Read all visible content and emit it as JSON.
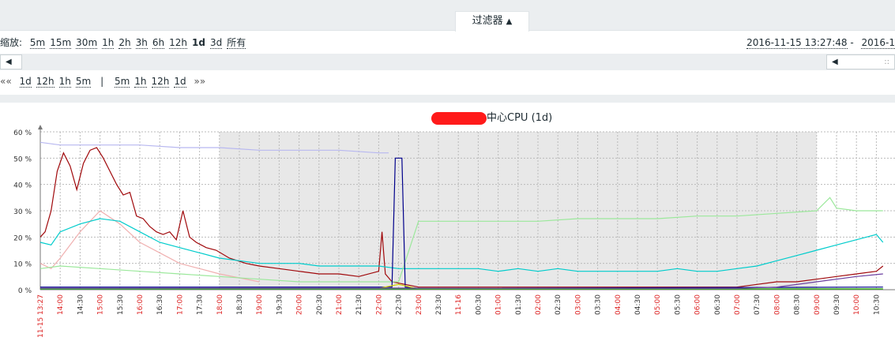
{
  "filter": {
    "label": "过滤器",
    "arrow": "▲"
  },
  "zoom": {
    "label": "缩放:",
    "options": [
      "5m",
      "15m",
      "30m",
      "1h",
      "2h",
      "3h",
      "6h",
      "12h",
      "1d",
      "3d",
      "所有"
    ],
    "active": "1d"
  },
  "date_range": {
    "from": "2016-11-15 13:27:48",
    "separator": " - ",
    "to": "2016-1"
  },
  "nav": {
    "back": "««",
    "left": [
      "1d",
      "12h",
      "1h",
      "5m"
    ],
    "divider": "|",
    "right": [
      "5m",
      "1h",
      "12h",
      "1d"
    ],
    "forward": "»»"
  },
  "scroll": {
    "left_arrow": "◀",
    "right_arrow": "◀",
    "grip": "::"
  },
  "chart_data": {
    "type": "line",
    "title": "中心CPU (1d)",
    "ylim": [
      0,
      60
    ],
    "y_ticks": [
      "0 %",
      "10 %",
      "20 %",
      "30 %",
      "40 %",
      "50 %",
      "60 %"
    ],
    "x_ticks": [
      {
        "label": "11-15 13:27",
        "red": true
      },
      {
        "label": "14:00",
        "red": true
      },
      {
        "label": "14:30",
        "red": false
      },
      {
        "label": "15:00",
        "red": true
      },
      {
        "label": "15:30",
        "red": false
      },
      {
        "label": "16:00",
        "red": true
      },
      {
        "label": "16:30",
        "red": false
      },
      {
        "label": "17:00",
        "red": true
      },
      {
        "label": "17:30",
        "red": false
      },
      {
        "label": "18:00",
        "red": true
      },
      {
        "label": "18:30",
        "red": false
      },
      {
        "label": "19:00",
        "red": true
      },
      {
        "label": "19:30",
        "red": false
      },
      {
        "label": "20:00",
        "red": true
      },
      {
        "label": "20:30",
        "red": false
      },
      {
        "label": "21:00",
        "red": true
      },
      {
        "label": "21:30",
        "red": false
      },
      {
        "label": "22:00",
        "red": true
      },
      {
        "label": "22:30",
        "red": false
      },
      {
        "label": "23:00",
        "red": true
      },
      {
        "label": "23:30",
        "red": false
      },
      {
        "label": "11-16",
        "red": true
      },
      {
        "label": "00:30",
        "red": false
      },
      {
        "label": "01:00",
        "red": true
      },
      {
        "label": "01:30",
        "red": false
      },
      {
        "label": "02:00",
        "red": true
      },
      {
        "label": "02:30",
        "red": false
      },
      {
        "label": "03:00",
        "red": true
      },
      {
        "label": "03:30",
        "red": false
      },
      {
        "label": "04:00",
        "red": true
      },
      {
        "label": "04:30",
        "red": false
      },
      {
        "label": "05:00",
        "red": true
      },
      {
        "label": "05:30",
        "red": false
      },
      {
        "label": "06:00",
        "red": true
      },
      {
        "label": "06:30",
        "red": false
      },
      {
        "label": "07:00",
        "red": true
      },
      {
        "label": "07:30",
        "red": false
      },
      {
        "label": "08:00",
        "red": true
      },
      {
        "label": "08:30",
        "red": false
      },
      {
        "label": "09:00",
        "red": true
      },
      {
        "label": "09:30",
        "red": false
      },
      {
        "label": "10:00",
        "red": true
      },
      {
        "label": "10:30",
        "red": false
      }
    ],
    "shaded_hours": {
      "from": "18:00",
      "to": "09:00"
    },
    "grid": true,
    "legend_position": "bottom",
    "series": [
      {
        "color": "#b8b8f0",
        "x": [
          "13:27",
          "14:00",
          "15:00",
          "16:00",
          "17:00",
          "18:00",
          "19:00",
          "20:00",
          "21:00",
          "22:00",
          "22:15",
          "22:20"
        ],
        "values": [
          56,
          55,
          55,
          55,
          54,
          54,
          53,
          53,
          53,
          52,
          52,
          null
        ]
      },
      {
        "color": "#a0080b",
        "x": [
          "13:27",
          "13:35",
          "13:45",
          "13:55",
          "14:05",
          "14:15",
          "14:25",
          "14:35",
          "14:45",
          "14:55",
          "15:05",
          "15:15",
          "15:25",
          "15:35",
          "15:45",
          "15:55",
          "16:05",
          "16:15",
          "16:25",
          "16:35",
          "16:45",
          "16:55",
          "17:05",
          "17:15",
          "17:25",
          "17:40",
          "17:55",
          "18:15",
          "18:40",
          "19:00",
          "19:30",
          "20:00",
          "20:30",
          "21:00",
          "21:30",
          "22:00",
          "22:05",
          "22:10",
          "22:20",
          "23:00",
          "00:00",
          "01:00",
          "02:00",
          "03:00",
          "04:00",
          "05:00",
          "06:00",
          "07:00",
          "07:30",
          "08:00",
          "08:30",
          "09:00",
          "09:30",
          "10:00",
          "10:30",
          "10:40"
        ],
        "values": [
          20,
          22,
          30,
          45,
          52,
          47,
          38,
          48,
          53,
          54,
          50,
          45,
          40,
          36,
          37,
          28,
          27,
          24,
          22,
          21,
          22,
          19,
          30,
          20,
          18,
          16,
          15,
          12,
          10,
          9,
          8,
          7,
          6,
          6,
          5,
          7,
          22,
          6,
          3,
          1,
          1,
          1,
          1,
          1,
          1,
          1,
          1,
          1,
          2,
          3,
          3,
          4,
          5,
          6,
          7,
          9
        ]
      },
      {
        "color": "#f0b0b0",
        "x": [
          "13:27",
          "13:45",
          "14:00",
          "14:30",
          "15:00",
          "15:30",
          "16:00",
          "16:30",
          "17:00",
          "17:30",
          "18:00",
          "19:00"
        ],
        "values": [
          10,
          8,
          12,
          22,
          30,
          25,
          18,
          14,
          10,
          8,
          6,
          3
        ]
      },
      {
        "color": "#00cccc",
        "x": [
          "13:27",
          "13:45",
          "14:00",
          "14:30",
          "15:00",
          "15:30",
          "16:00",
          "16:30",
          "17:00",
          "17:30",
          "18:00",
          "18:30",
          "19:00",
          "19:30",
          "20:00",
          "20:30",
          "21:00",
          "21:30",
          "22:00",
          "22:30",
          "23:00",
          "23:30",
          "00:00",
          "00:30",
          "01:00",
          "01:30",
          "02:00",
          "02:30",
          "03:00",
          "03:30",
          "04:00",
          "04:30",
          "05:00",
          "05:30",
          "06:00",
          "06:30",
          "07:00",
          "07:30",
          "08:00",
          "08:30",
          "09:00",
          "09:30",
          "10:00",
          "10:30",
          "10:40"
        ],
        "values": [
          18,
          17,
          22,
          25,
          27,
          26,
          22,
          18,
          16,
          14,
          12,
          11,
          10,
          10,
          10,
          9,
          9,
          9,
          9,
          8,
          8,
          8,
          8,
          8,
          7,
          8,
          7,
          8,
          7,
          7,
          7,
          7,
          7,
          8,
          7,
          7,
          8,
          9,
          11,
          13,
          15,
          17,
          19,
          21,
          18
        ]
      },
      {
        "color": "#9be89b",
        "x": [
          "13:27",
          "14:00",
          "15:00",
          "16:00",
          "17:00",
          "18:00",
          "19:00",
          "20:00",
          "21:00",
          "22:00",
          "22:30",
          "23:00",
          "00:00",
          "01:00",
          "02:00",
          "03:00",
          "04:00",
          "05:00",
          "06:00",
          "07:00",
          "08:00",
          "09:00",
          "09:20",
          "09:30",
          "10:00",
          "10:40"
        ],
        "values": [
          8,
          9,
          8,
          7,
          6,
          5,
          4,
          3,
          3,
          3,
          3,
          26,
          26,
          26,
          26,
          27,
          27,
          27,
          28,
          28,
          29,
          30,
          35,
          31,
          30,
          30
        ]
      },
      {
        "color": "#00008b",
        "x": [
          "13:27",
          "22:00",
          "22:20",
          "22:25",
          "22:30",
          "22:35",
          "22:40",
          "23:00",
          "10:40"
        ],
        "values": [
          1,
          1,
          1,
          50,
          50,
          50,
          1,
          0.5,
          1
        ]
      },
      {
        "color": "#d4d400",
        "x": [
          "13:27",
          "22:00",
          "22:30",
          "23:00",
          "10:40"
        ],
        "values": [
          0.5,
          0.5,
          2,
          0.3,
          0.3
        ]
      },
      {
        "color": "#22aa22",
        "x": [
          "13:27",
          "10:40"
        ],
        "values": [
          0.3,
          0.3
        ]
      },
      {
        "color": "#6b3fa0",
        "x": [
          "13:27",
          "22:00",
          "07:00",
          "08:00",
          "09:00",
          "10:00",
          "10:40"
        ],
        "values": [
          0.6,
          0.6,
          0.5,
          1,
          3,
          5,
          6
        ]
      }
    ]
  }
}
